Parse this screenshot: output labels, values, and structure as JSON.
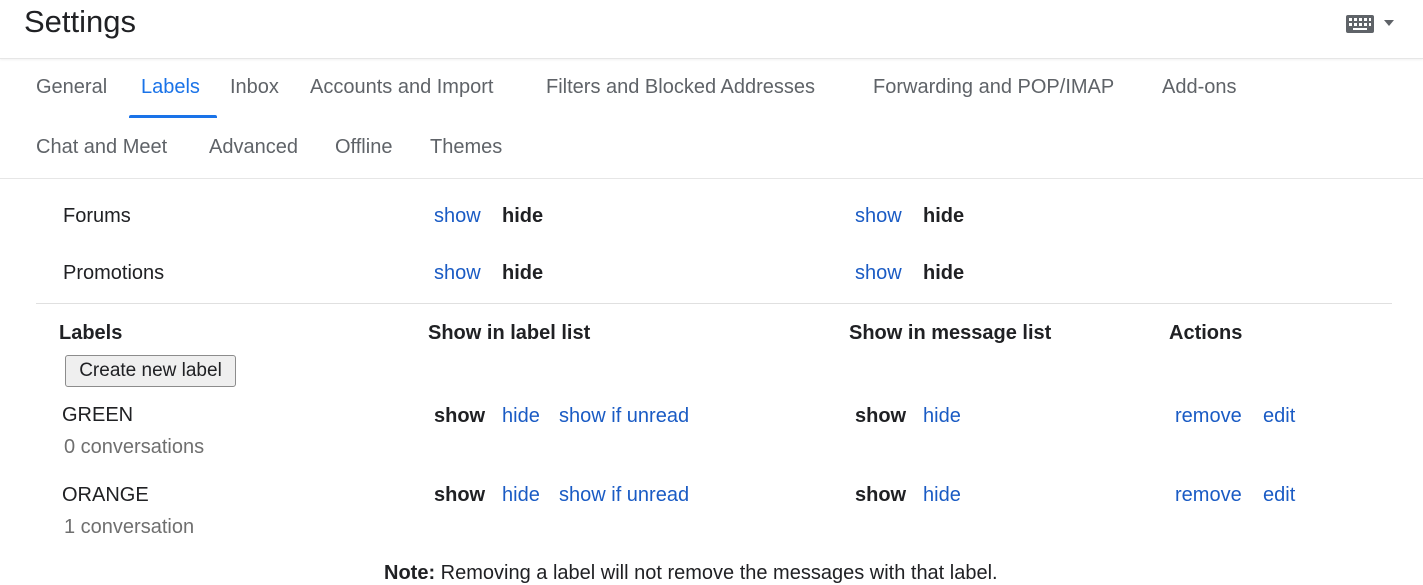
{
  "header": {
    "title": "Settings",
    "icons": [
      "keyboard-icon",
      "caret-down-icon"
    ]
  },
  "tabs": [
    {
      "label": "General",
      "active": false
    },
    {
      "label": "Labels",
      "active": true
    },
    {
      "label": "Inbox",
      "active": false
    },
    {
      "label": "Accounts and Import",
      "active": false
    },
    {
      "label": "Filters and Blocked Addresses",
      "active": false
    },
    {
      "label": "Forwarding and POP/IMAP",
      "active": false
    },
    {
      "label": "Add-ons",
      "active": false
    },
    {
      "label": "Chat and Meet",
      "active": false
    },
    {
      "label": "Advanced",
      "active": false
    },
    {
      "label": "Offline",
      "active": false
    },
    {
      "label": "Themes",
      "active": false
    }
  ],
  "categories": [
    {
      "name": "Forums",
      "label_list": {
        "show": "show",
        "hide": "hide",
        "selected": "hide"
      },
      "message_list": {
        "show": "show",
        "hide": "hide",
        "selected": "hide"
      }
    },
    {
      "name": "Promotions",
      "label_list": {
        "show": "show",
        "hide": "hide",
        "selected": "hide"
      },
      "message_list": {
        "show": "show",
        "hide": "hide",
        "selected": "hide"
      }
    }
  ],
  "labels_section": {
    "headers": {
      "labels": "Labels",
      "label_list": "Show in label list",
      "message_list": "Show in message list",
      "actions": "Actions"
    },
    "create_button": "Create new label",
    "labels": [
      {
        "name": "GREEN",
        "count": "0 conversations",
        "label_list": {
          "show": "show",
          "hide": "hide",
          "show_if_unread": "show if unread",
          "selected": "show"
        },
        "message_list": {
          "show": "show",
          "hide": "hide",
          "selected": "show"
        },
        "actions": {
          "remove": "remove",
          "edit": "edit"
        }
      },
      {
        "name": "ORANGE",
        "count": "1 conversation",
        "label_list": {
          "show": "show",
          "hide": "hide",
          "show_if_unread": "show if unread",
          "selected": "show"
        },
        "message_list": {
          "show": "show",
          "hide": "hide",
          "selected": "show"
        },
        "actions": {
          "remove": "remove",
          "edit": "edit"
        }
      }
    ]
  },
  "note": {
    "prefix": "Note:",
    "text": " Removing a label will not remove the messages with that label."
  },
  "colors": {
    "accent": "#1a73e8",
    "link": "#1a5bc4",
    "tab_text": "#5f6368",
    "muted_text": "#6f6f6f"
  }
}
